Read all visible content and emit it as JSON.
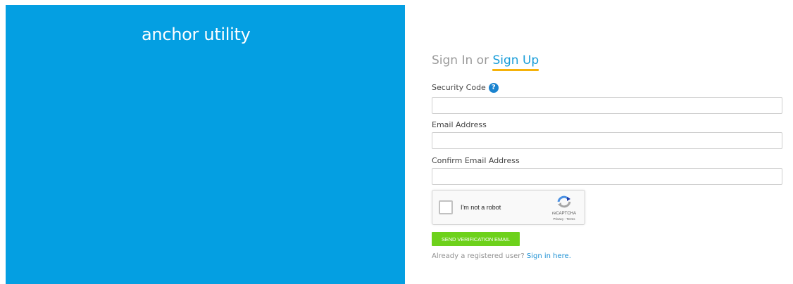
{
  "brand": {
    "title": "anchor utility",
    "panel_color": "#049fe2"
  },
  "auth": {
    "heading_prefix": "Sign In or",
    "heading_active": "Sign Up",
    "active_color": "#169cd8",
    "underline_color": "#f5b20a"
  },
  "fields": {
    "security_code": {
      "label": "Security Code",
      "value": "",
      "help_icon": "question-circle-icon"
    },
    "email": {
      "label": "Email Address",
      "value": ""
    },
    "confirm_email": {
      "label": "Confirm Email Address",
      "value": ""
    }
  },
  "recaptcha": {
    "checkbox_label": "I'm not a robot",
    "brand": "reCAPTCHA",
    "terms": "Privacy - Terms",
    "checked": false
  },
  "actions": {
    "send_label": "SEND VERIFICATION EMAIL",
    "button_color": "#6dd11b"
  },
  "footer": {
    "prompt": "Already a registered user?",
    "link": "Sign in here."
  }
}
